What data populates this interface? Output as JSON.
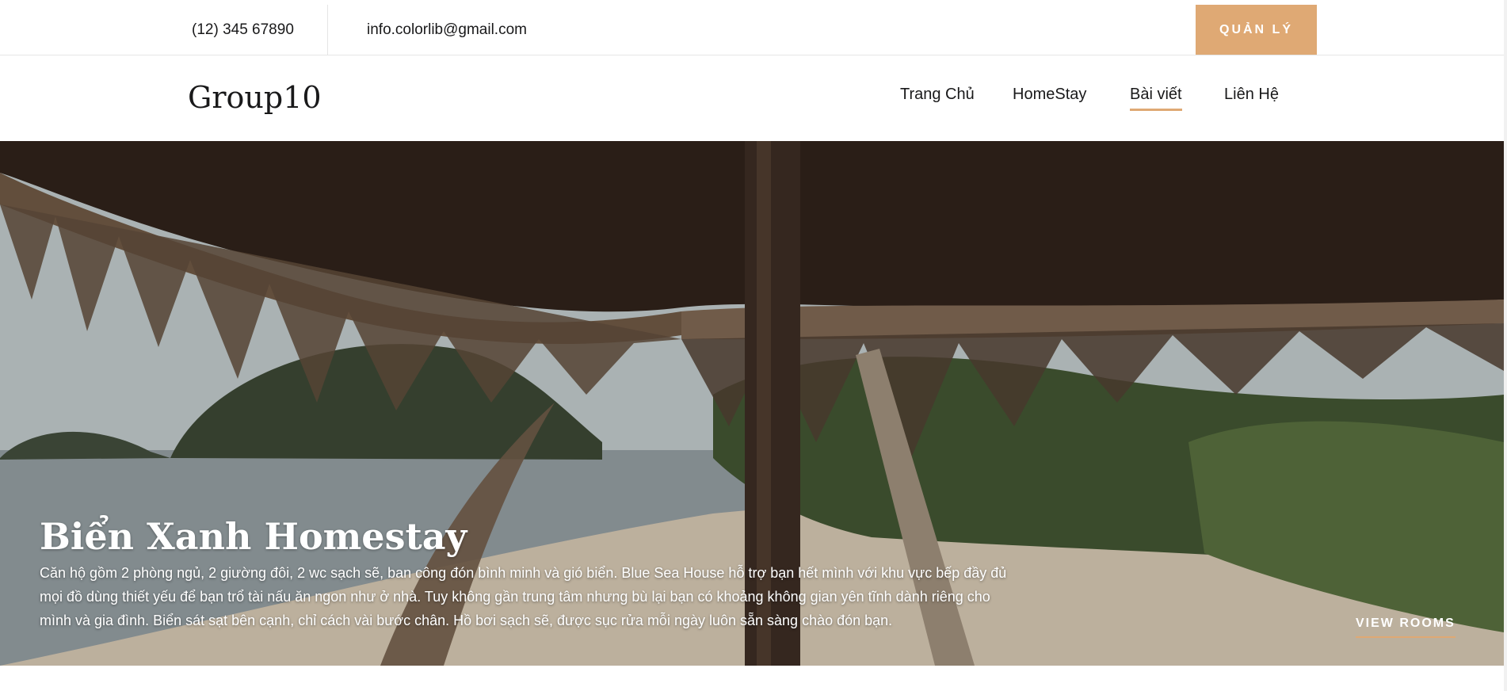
{
  "topbar": {
    "phone": "(12) 345 67890",
    "email": "info.colorlib@gmail.com",
    "manage_button": "QUẢN LÝ"
  },
  "navbar": {
    "logo": "Group10",
    "items": [
      {
        "label": "Trang Chủ"
      },
      {
        "label": "HomeStay"
      },
      {
        "label": "Bài viết",
        "active": true
      },
      {
        "label": "Liên Hệ"
      }
    ]
  },
  "hero": {
    "title": "Biển Xanh Homestay",
    "description": "Căn hộ gồm 2 phòng ngủ, 2 giường đôi, 2 wc sạch sẽ, ban công đón bình minh và gió biển. Blue Sea House hỗ trợ bạn hết mình với khu vực bếp đầy đủ mọi đồ dùng thiết yếu để bạn trổ tài nấu ăn ngon như ở nhà. Tuy không gần trung tâm nhưng bù lại bạn có khoảng không gian yên tĩnh dành riêng cho mình và gia đình. Biển sát sạt bên cạnh, chỉ cách vài bước chân. Hồ bơi sạch sẽ, được sục rửa mỗi ngày luôn sẵn sàng chào đón bạn.",
    "cta": "VIEW ROOMS"
  },
  "colors": {
    "accent": "#dfa974",
    "text": "#19191a"
  }
}
